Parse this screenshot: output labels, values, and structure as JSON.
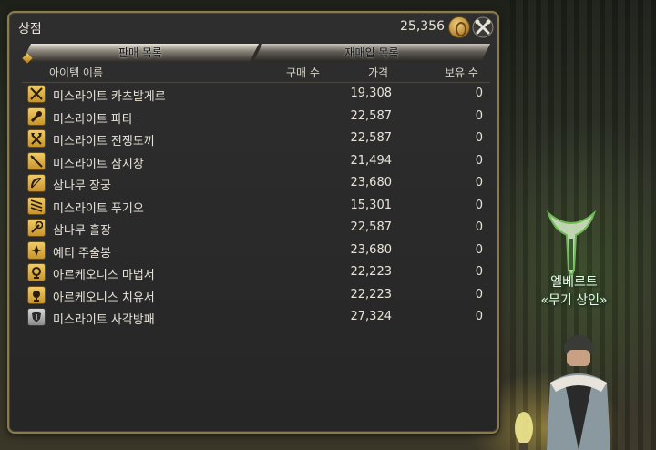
{
  "window": {
    "title": "상점",
    "gil": "25,356",
    "gil_icon": "gil-coin-icon",
    "settings_icon": "crossed-tools-icon"
  },
  "tabs": [
    {
      "label": "판매 목록",
      "active": true
    },
    {
      "label": "재매입 목록",
      "active": false
    }
  ],
  "columns": {
    "name": "아이템 이름",
    "qty": "구매 수",
    "price": "가격",
    "owned": "보유 수"
  },
  "items": [
    {
      "name": "미스라이트 카츠발게르",
      "price": "19,308",
      "owned": "0",
      "icon": "sword-icon"
    },
    {
      "name": "미스라이트 파타",
      "price": "22,587",
      "owned": "0",
      "icon": "fist-weapon-icon"
    },
    {
      "name": "미스라이트 전쟁도끼",
      "price": "22,587",
      "owned": "0",
      "icon": "axe-icon"
    },
    {
      "name": "미스라이트 삼지창",
      "price": "21,494",
      "owned": "0",
      "icon": "lance-icon"
    },
    {
      "name": "삼나무 장궁",
      "price": "23,680",
      "owned": "0",
      "icon": "bow-icon"
    },
    {
      "name": "미스라이트 푸기오",
      "price": "15,301",
      "owned": "0",
      "icon": "dagger-icon"
    },
    {
      "name": "삼나무 흘장",
      "price": "22,587",
      "owned": "0",
      "icon": "staff-icon"
    },
    {
      "name": "예티 주술봉",
      "price": "23,680",
      "owned": "0",
      "icon": "wand-icon"
    },
    {
      "name": "아르케오니스 마법서",
      "price": "22,223",
      "owned": "0",
      "icon": "arcanist-book-icon"
    },
    {
      "name": "아르케오니스 치유서",
      "price": "22,223",
      "owned": "0",
      "icon": "scholar-book-icon"
    },
    {
      "name": "미스라이트 사각방패",
      "price": "27,324",
      "owned": "0",
      "icon": "shield-icon"
    }
  ],
  "npc": {
    "name": "엘베르트",
    "role": "«무기 상인»"
  }
}
